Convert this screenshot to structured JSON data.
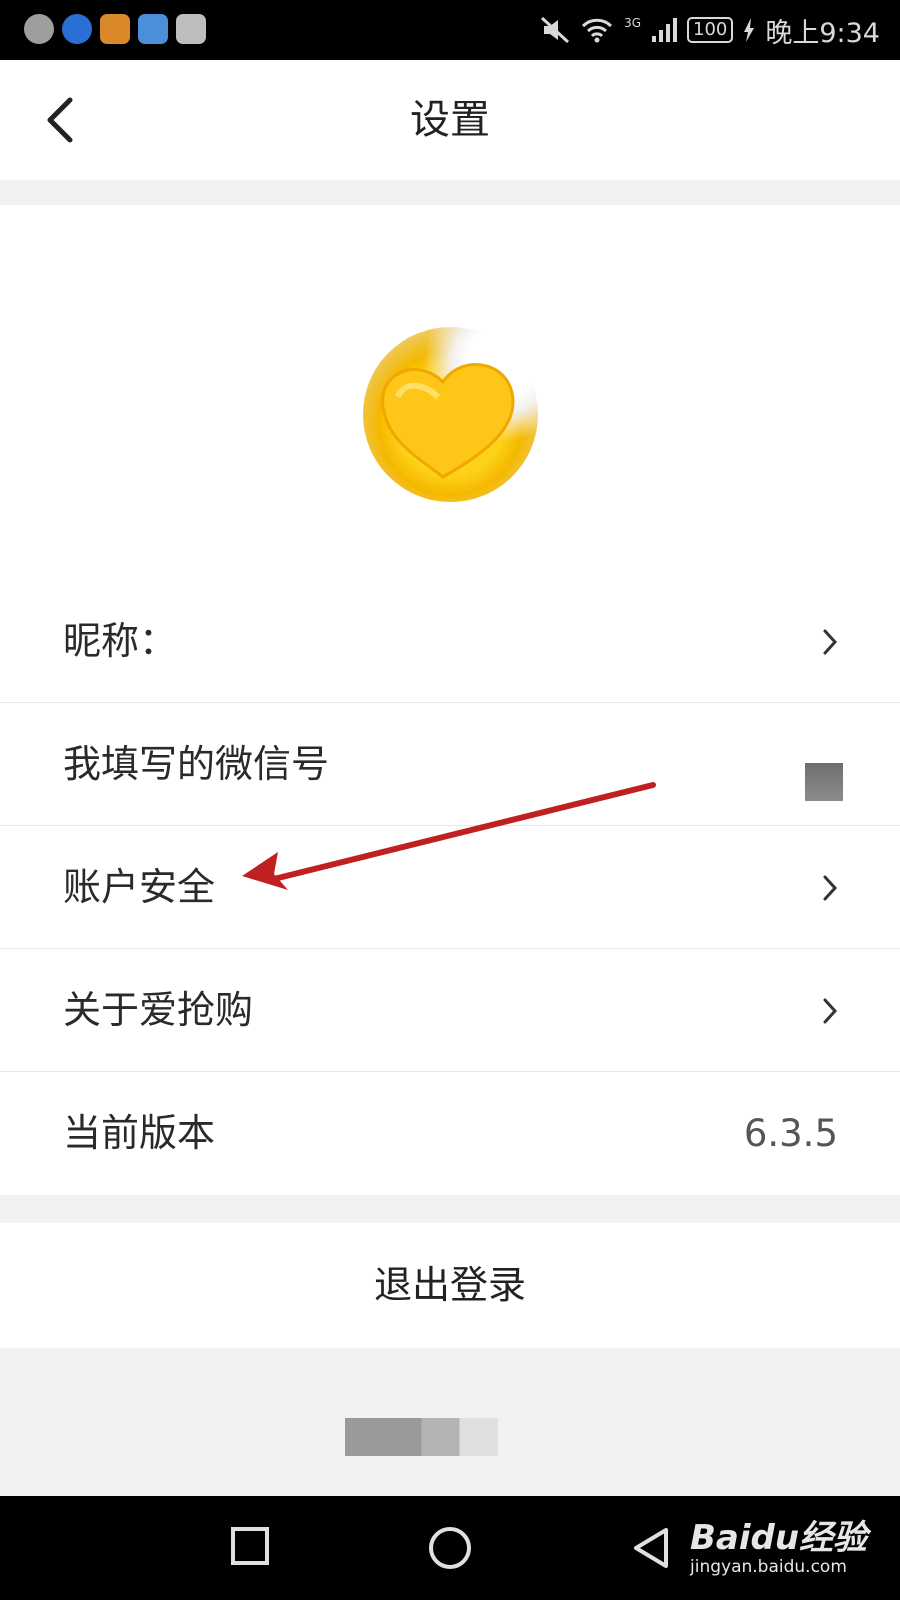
{
  "status_bar": {
    "time": "晚上9:34",
    "battery": "100",
    "network": "3G",
    "app_icon_colors": [
      "#9e9e9e",
      "#2a6fd6",
      "#d9892a",
      "#4a8fd8",
      "#bdbdbd"
    ]
  },
  "header": {
    "title": "设置",
    "back_icon": "chevron-left-icon"
  },
  "profile": {
    "avatar": "yellow-heart-avatar"
  },
  "settings_rows": [
    {
      "label": "昵称："
    },
    {
      "label": "我填写的微信号"
    },
    {
      "label": "账户安全"
    },
    {
      "label": "关于爱抢购"
    },
    {
      "label": "当前版本",
      "value": "6.3.5"
    }
  ],
  "logout": {
    "label": "退出登录"
  },
  "annotation": {
    "color": "#c0201f"
  },
  "watermark": {
    "brand": "Baidu经验",
    "url": "jingyan.baidu.com"
  },
  "nav": {
    "recents_icon": "square-icon",
    "home_icon": "circle-icon",
    "back_icon": "triangle-back-icon"
  }
}
